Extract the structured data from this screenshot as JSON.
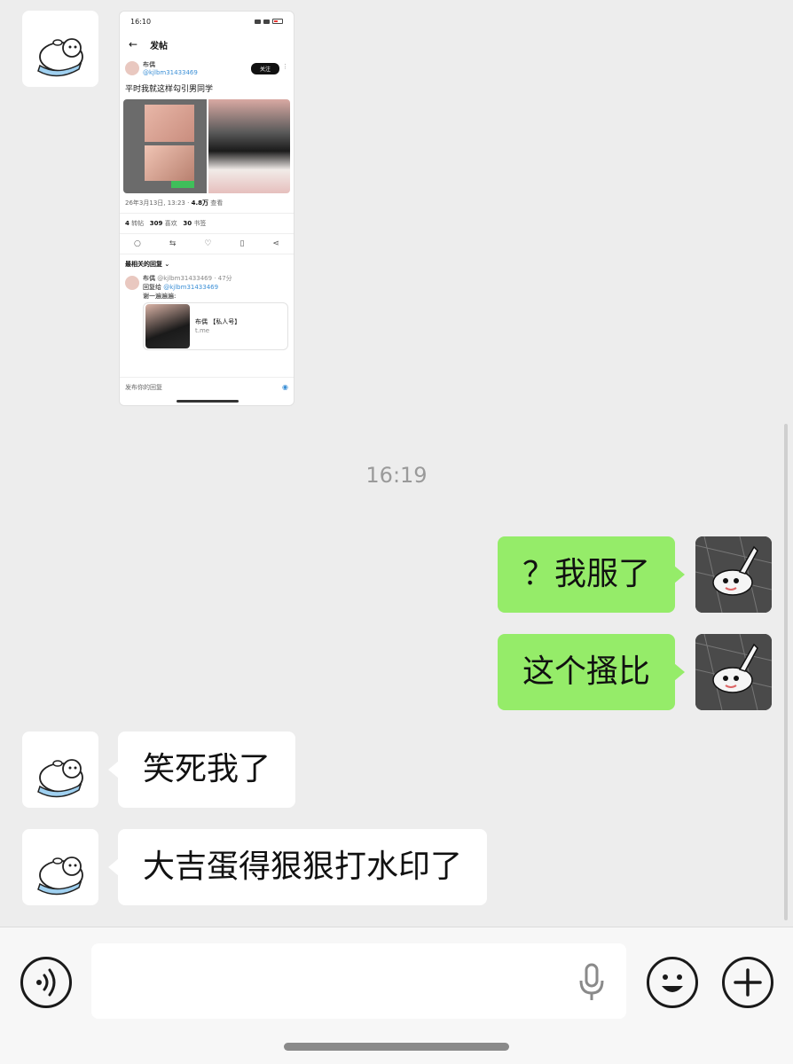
{
  "timestamp": "16:19",
  "messages": [
    {
      "side": "in",
      "type": "image"
    },
    {
      "side": "out",
      "text": "？我服了"
    },
    {
      "side": "out",
      "text": "这个搔比"
    },
    {
      "side": "in",
      "text": "笑死我了"
    },
    {
      "side": "in",
      "text": "大吉蛋得狠狠打水印了"
    }
  ],
  "screenshot": {
    "status_time": "16:10",
    "header_title": "发帖",
    "back_glyph": "←",
    "user_name": "布偶",
    "user_handle": "@kjlbm31433469",
    "follow_label": "关注",
    "post_text": "平时我就这样勾引男同学",
    "meta_date": "26年3月13日, 13:23 ·",
    "meta_views": "4.8万",
    "meta_views_label": "查看",
    "stat_reposts": "4",
    "stat_reposts_label": "转帖",
    "stat_likes": "309",
    "stat_likes_label": "喜欢",
    "stat_bookmarks": "30",
    "stat_bookmarks_label": "书签",
    "sort_label": "最相关的回复",
    "reply_name": "布偶",
    "reply_meta": "@kjlbm31433469 · 47分",
    "reply_to_prefix": "回复给",
    "reply_to_handle": "@kjlbm31433469",
    "reply_text": "谢一遍遍遍:",
    "card_title": "布偶 【私人号】",
    "card_domain": "t.me",
    "reply_placeholder": "发布你的回复"
  },
  "colors": {
    "background": "#ededed",
    "bubble_out": "#95ec69",
    "bubble_in": "#ffffff",
    "timestamp_text": "#9a9a9a"
  },
  "icons": {
    "voice": "voice-wave-icon",
    "mic": "microphone-icon",
    "emoji": "smiley-icon",
    "plus": "plus-icon"
  }
}
